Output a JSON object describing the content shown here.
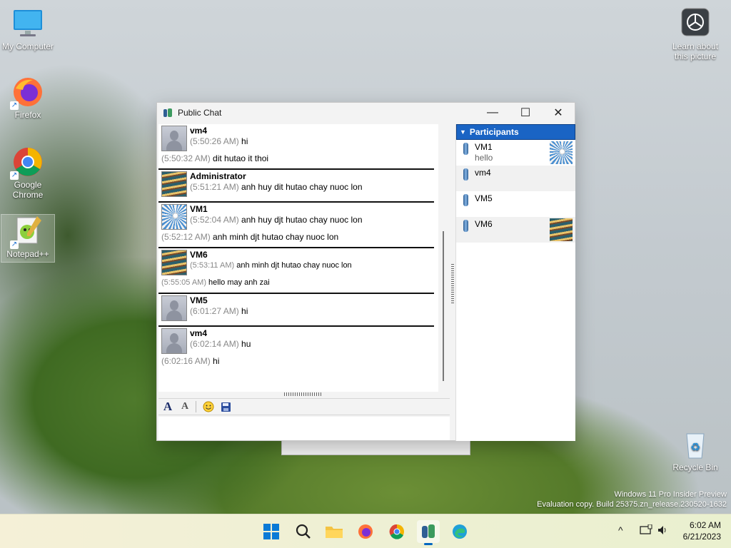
{
  "desktop": {
    "icons": [
      {
        "label": "My Computer"
      },
      {
        "label": "Firefox"
      },
      {
        "label": "Google Chrome"
      },
      {
        "label": "Notepad++"
      },
      {
        "label": "Learn about this picture"
      },
      {
        "label": "Recycle Bin"
      }
    ],
    "watermark": {
      "line1": "Windows 11 Pro Insider Preview",
      "line2": "Evaluation copy. Build 25375.zn_release.230520-1632"
    }
  },
  "window": {
    "title": "Public Chat",
    "controls": {
      "minimize": "—",
      "maximize": "☐",
      "close": "✕"
    }
  },
  "messages": [
    {
      "nick": "vm4",
      "avatar": "person",
      "lines": [
        {
          "time": "(5:50:26 AM)",
          "text": "hi"
        },
        {
          "time": "(5:50:32 AM)",
          "text": "dit hutao it thoi"
        }
      ]
    },
    {
      "nick": "Administrator",
      "avatar": "stairs",
      "lines": [
        {
          "time": "(5:51:21 AM)",
          "text": "anh huy dit hutao chay nuoc lon"
        }
      ]
    },
    {
      "nick": "VM1",
      "avatar": "wheel",
      "lines": [
        {
          "time": "(5:52:04 AM)",
          "text": "anh huy djt hutao chay nuoc lon"
        },
        {
          "time": "(5:52:12 AM)",
          "text": "anh minh djt hutao chay nuoc lon"
        }
      ]
    },
    {
      "nick": "VM6",
      "avatar": "stairs",
      "lines": [
        {
          "time": "(5:53:11 AM)",
          "text": "anh minh djt hutao chay nuoc lon"
        },
        {
          "time": "(5:55:05 AM)",
          "text": "hello may anh zai"
        }
      ]
    },
    {
      "nick": "VM5",
      "avatar": "person",
      "lines": [
        {
          "time": "(6:01:27 AM)",
          "text": "hi"
        }
      ]
    },
    {
      "nick": "vm4",
      "avatar": "person",
      "lines": [
        {
          "time": "(6:02:14 AM)",
          "text": "hu"
        },
        {
          "time": "(6:02:16 AM)",
          "text": "hi"
        }
      ]
    }
  ],
  "toolbar": {
    "font_icon": "A",
    "font_color_icon": "A",
    "emoticon_icon": "☺",
    "save_icon": "💾"
  },
  "participants": {
    "header": "Participants",
    "list": [
      {
        "name": "VM1",
        "status": "hello",
        "avatar": "wheel"
      },
      {
        "name": "vm4",
        "status": "",
        "avatar": ""
      },
      {
        "name": "VM5",
        "status": "",
        "avatar": ""
      },
      {
        "name": "VM6",
        "status": "",
        "avatar": "stairs"
      }
    ]
  },
  "taskbar": {
    "apps": [
      "windows-start",
      "search",
      "file-explorer",
      "firefox",
      "chrome",
      "chat-app",
      "edge"
    ],
    "tray_chevron": "^",
    "clock": {
      "time": "6:02 AM",
      "date": "6/21/2023"
    }
  }
}
